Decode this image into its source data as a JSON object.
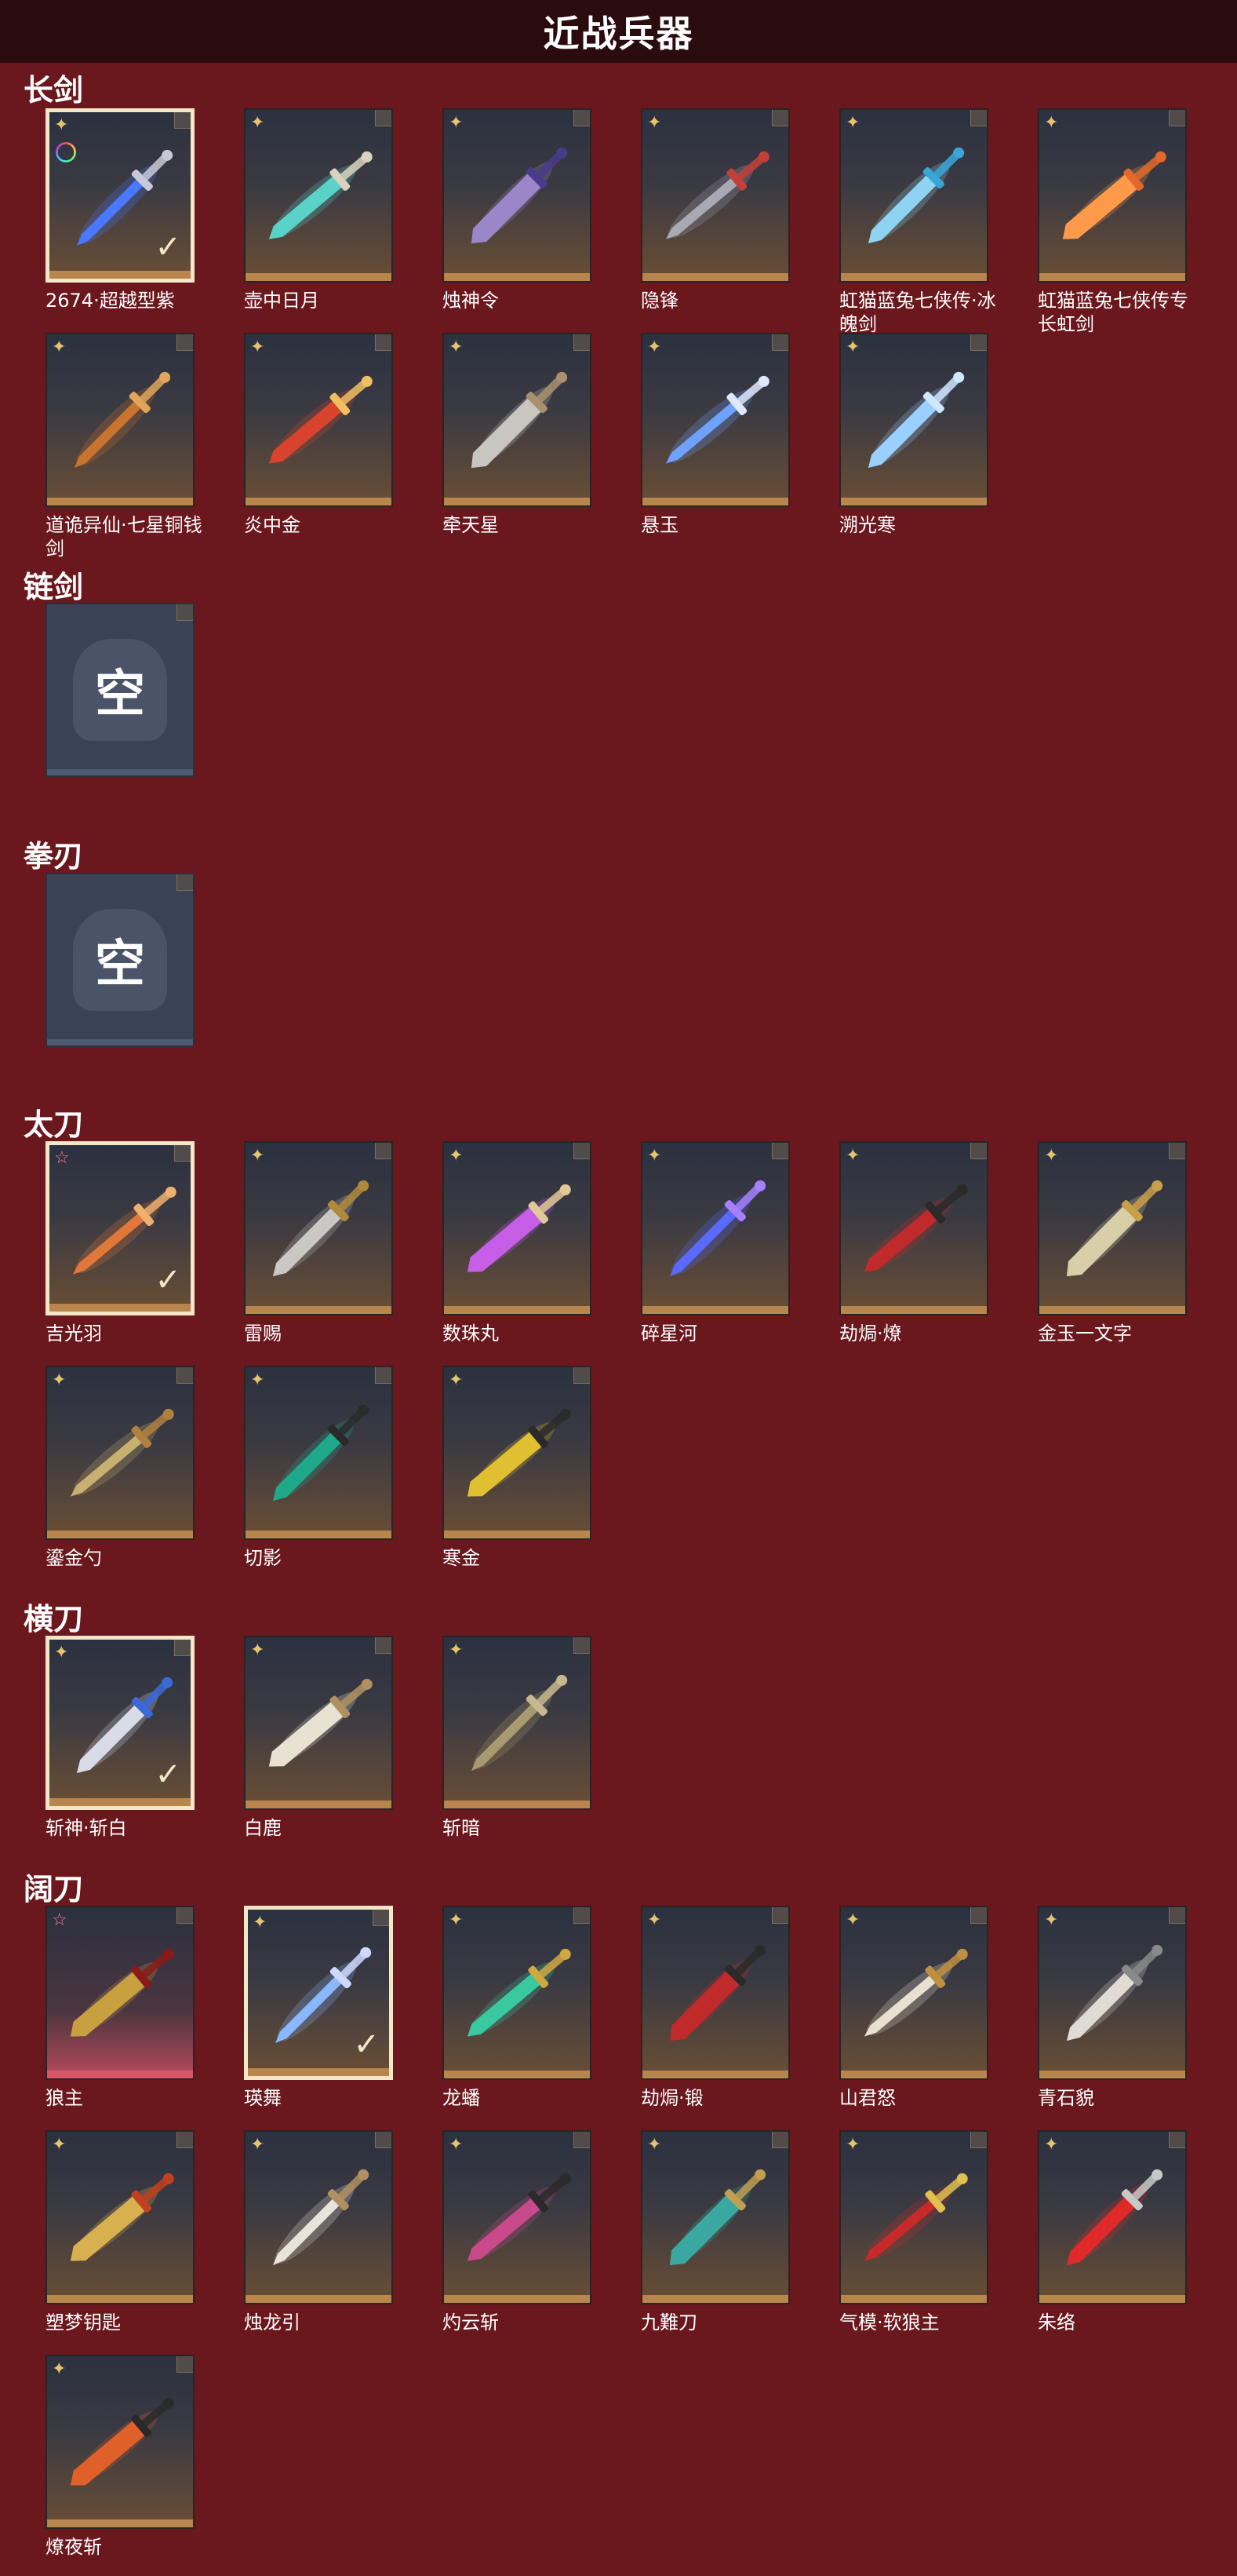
{
  "page": {
    "title": "近战兵器"
  },
  "sections": [
    {
      "id": "changjian",
      "title": "长剑",
      "items": [
        {
          "name": "2674·超越型紫",
          "selected": true,
          "badge": "gold",
          "rainbow": true,
          "blade": "#4a78ff",
          "hilt": "#c9c9d6"
        },
        {
          "name": "壶中日月",
          "badge": "gold",
          "blade": "#5ad2c8",
          "hilt": "#d9d2c0"
        },
        {
          "name": "烛神令",
          "badge": "gold",
          "blade": "#9a86c8",
          "hilt": "#4a3a8a"
        },
        {
          "name": "隐锋",
          "badge": "gold",
          "blade": "#a8a9b3",
          "hilt": "#c2403a"
        },
        {
          "name": "虹猫蓝兔七侠传·冰魄剑",
          "badge": "gold",
          "blade": "#8ed4f2",
          "hilt": "#3aa6d8"
        },
        {
          "name": "虹猫蓝兔七侠传专长虹剑",
          "badge": "gold",
          "blade": "#ff9a4a",
          "hilt": "#e2682c"
        },
        {
          "name": "道诡异仙·七星铜钱剑",
          "badge": "gold",
          "blade": "#c8742e",
          "hilt": "#e0a45a"
        },
        {
          "name": "炎中金",
          "badge": "gold",
          "blade": "#d8432e",
          "hilt": "#f0c060"
        },
        {
          "name": "牵天星",
          "badge": "gold",
          "blade": "#c8c6c0",
          "hilt": "#a89070"
        },
        {
          "name": "悬玉",
          "badge": "gold",
          "blade": "#6fa2ff",
          "hilt": "#e0e8ff"
        },
        {
          "name": "溯光寒",
          "badge": "gold",
          "blade": "#9ad0ff",
          "hilt": "#cfe8ff"
        }
      ]
    },
    {
      "id": "lianjian",
      "title": "链剑",
      "items": [
        {
          "name": "",
          "empty": true,
          "empty_text": "空"
        }
      ]
    },
    {
      "id": "quanren",
      "title": "拳刃",
      "items": [
        {
          "name": "",
          "empty": true,
          "empty_text": "空"
        }
      ]
    },
    {
      "id": "taidao",
      "title": "太刀",
      "items": [
        {
          "name": "吉光羽",
          "selected": true,
          "badge": "pink",
          "blade": "#e0783a",
          "hilt": "#f0b070"
        },
        {
          "name": "雷赐",
          "badge": "gold",
          "blade": "#c9c8c4",
          "hilt": "#b08a3a"
        },
        {
          "name": "数珠丸",
          "badge": "gold",
          "blade": "#c65ee8",
          "hilt": "#e0c89a"
        },
        {
          "name": "碎星河",
          "badge": "gold",
          "blade": "#5a6aff",
          "hilt": "#a880ff"
        },
        {
          "name": "劫焗·燎",
          "badge": "gold",
          "blade": "#c02a2a",
          "hilt": "#2a2a2a"
        },
        {
          "name": "金玉一文字",
          "badge": "gold",
          "blade": "#d8cfa8",
          "hilt": "#c9a04a"
        },
        {
          "name": "鎏金勺",
          "badge": "gold",
          "blade": "#c8b070",
          "hilt": "#b08040"
        },
        {
          "name": "切影",
          "badge": "gold",
          "blade": "#1fa88a",
          "hilt": "#2a2a2a"
        },
        {
          "name": "寒金",
          "badge": "gold",
          "blade": "#e0c030",
          "hilt": "#2a2a2a"
        }
      ]
    },
    {
      "id": "hengdao",
      "title": "横刀",
      "items": [
        {
          "name": "斩神·斩白",
          "selected": true,
          "badge": "gold",
          "blade": "#d8dce6",
          "hilt": "#3a6ad8"
        },
        {
          "name": "白鹿",
          "badge": "gold",
          "blade": "#e8e2d2",
          "hilt": "#b09060"
        },
        {
          "name": "斩暗",
          "badge": "gold",
          "blade": "#a89a70",
          "hilt": "#c8b890"
        }
      ]
    },
    {
      "id": "kuodao",
      "title": "阔刀",
      "items": [
        {
          "name": "狼主",
          "badge": "pink",
          "pink": true,
          "blade": "#c8a040",
          "hilt": "#8a1a1a"
        },
        {
          "name": "瑛舞",
          "selected": true,
          "badge": "gold",
          "blade": "#8ab8ff",
          "hilt": "#d0d8ff"
        },
        {
          "name": "龙蟠",
          "badge": "gold",
          "blade": "#3ac8a0",
          "hilt": "#d0a840"
        },
        {
          "name": "劫焗·锻",
          "badge": "gold",
          "blade": "#c02a2a",
          "hilt": "#2a2a2a"
        },
        {
          "name": "山君怒",
          "badge": "gold",
          "blade": "#e8e0d0",
          "hilt": "#c09040"
        },
        {
          "name": "青石貌",
          "badge": "gold",
          "blade": "#e0dcd4",
          "hilt": "#8a8a8a"
        },
        {
          "name": "塑梦钥匙",
          "badge": "gold",
          "blade": "#d8b050",
          "hilt": "#c04020"
        },
        {
          "name": "烛龙引",
          "badge": "gold",
          "blade": "#e8e4dc",
          "hilt": "#b09060"
        },
        {
          "name": "灼云斩",
          "badge": "gold",
          "blade": "#c84a8a",
          "hilt": "#2a2a2a"
        },
        {
          "name": "九難刀",
          "badge": "gold",
          "blade": "#3aa8a0",
          "hilt": "#c0a050"
        },
        {
          "name": "气模·软狼主",
          "badge": "gold",
          "blade": "#c82a2a",
          "hilt": "#e0c050"
        },
        {
          "name": "朱络",
          "badge": "gold",
          "blade": "#e02a2a",
          "hilt": "#c8c8c8"
        },
        {
          "name": "燎夜斩",
          "badge": "gold",
          "blade": "#e0602a",
          "hilt": "#2a2a2a"
        }
      ]
    }
  ],
  "icons": {
    "gold_badge": "four-point-star-icon",
    "pink_badge": "star-outline-icon",
    "check": "checkmark-icon"
  },
  "colors": {
    "background": "#6a171d",
    "topbar": "#2a0b0e",
    "card_border_selected": "#f3e7c7",
    "card_footer": "#b8864d"
  }
}
